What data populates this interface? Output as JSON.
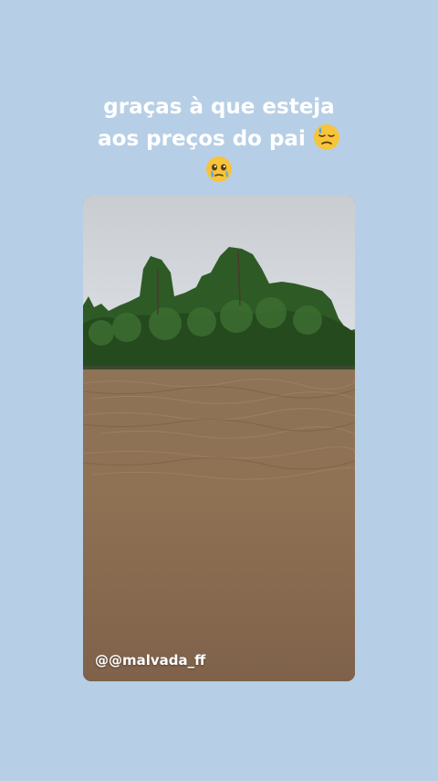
{
  "story": {
    "caption_line1": "graças à que esteja",
    "caption_line2": "aos preços do pai",
    "emoji_1": "downcast-face-with-sweat",
    "emoji_2": "face-holding-back-tears",
    "mention": "@@malvada_ff",
    "background_color": "#b7cfe6",
    "photo_description_icon": "river-forest-photo"
  }
}
